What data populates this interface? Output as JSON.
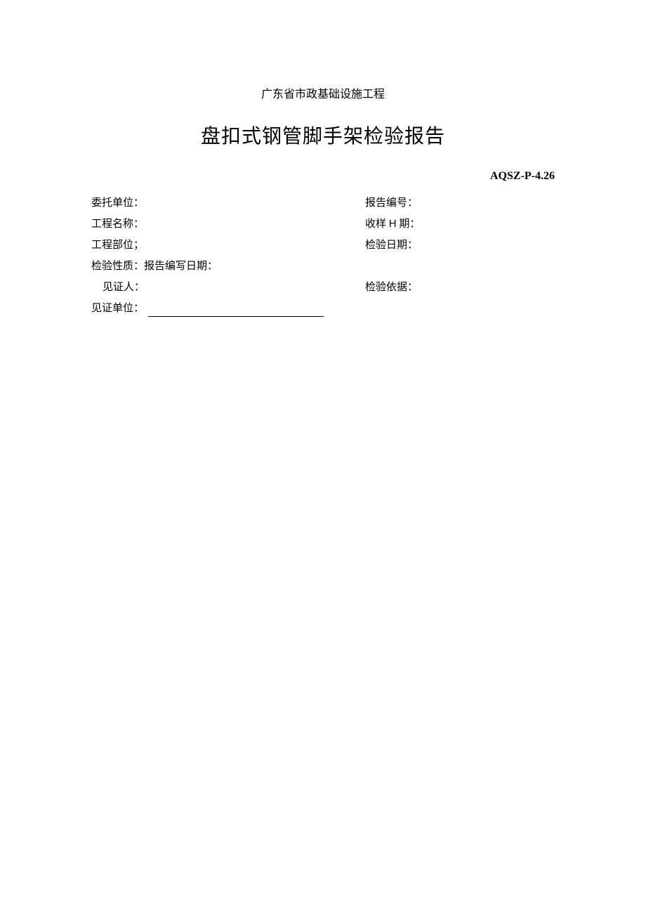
{
  "header": {
    "subtitle": "广东省市政基础设施工程",
    "title": "盘扣式钢管脚手架检验报告",
    "doc_code": "AQSZ-P-4.26"
  },
  "fields": {
    "left": {
      "client_unit": "委托单位：",
      "project_name": "工程名称：",
      "project_part": "工程部位；",
      "inspection_nature": "检验性质：报告编写日期：",
      "witness_person": "见证人：",
      "witness_unit": "见证单位："
    },
    "right": {
      "report_no": "报告编号：",
      "sample_date_prefix": "收样 ",
      "sample_date_h": "H",
      "sample_date_suffix": " 期：",
      "inspection_date": "检验日期：",
      "inspection_basis": "检验依据："
    }
  }
}
